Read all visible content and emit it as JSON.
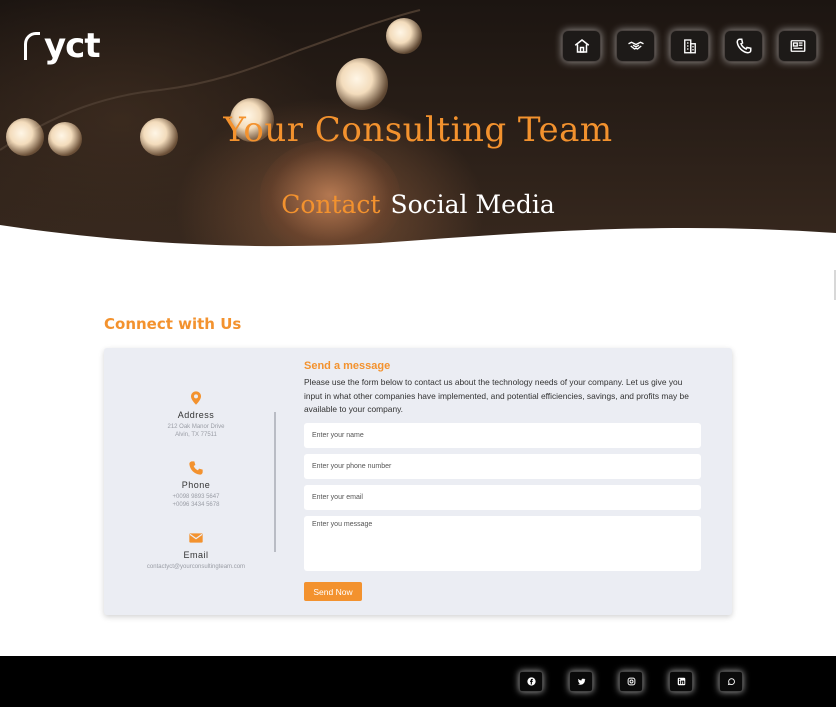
{
  "brand": {
    "logo_text": "yct"
  },
  "nav": {
    "items": [
      {
        "icon": "home-icon"
      },
      {
        "icon": "handshake-icon"
      },
      {
        "icon": "building-icon"
      },
      {
        "icon": "phone-icon"
      },
      {
        "icon": "newspaper-icon"
      }
    ]
  },
  "hero": {
    "title": "Your Consulting Team",
    "subtitle_accent": "Contact",
    "subtitle_rest": "Social Media"
  },
  "connect": {
    "title": "Connect with Us",
    "address": {
      "label": "Address",
      "line1": "212 Oak Manor Drive",
      "line2": "Alvin, TX 77511"
    },
    "phone": {
      "label": "Phone",
      "line1": "+0098 9893 5647",
      "line2": "+0096 3434 5678"
    },
    "email": {
      "label": "Email",
      "line1": "contactyct@yourconsultingteam.com"
    }
  },
  "form": {
    "title": "Send a message",
    "description": "Please use the form below to contact us about the technology needs of your company. Let us give you input in what other companies have implemented, and potential efficiencies, savings, and profits may be available to your company.",
    "name_placeholder": "Enter your name",
    "phone_placeholder": "Enter your phone number",
    "email_placeholder": "Enter your email",
    "message_placeholder": "Enter you message",
    "submit_label": "Send Now"
  },
  "footer": {
    "social": [
      "facebook-icon",
      "twitter-icon",
      "instagram-icon",
      "linkedin-icon",
      "whatsapp-icon"
    ]
  },
  "colors": {
    "accent": "#f3922e",
    "card_bg": "#ebedf3",
    "footer_bg": "#000000"
  }
}
